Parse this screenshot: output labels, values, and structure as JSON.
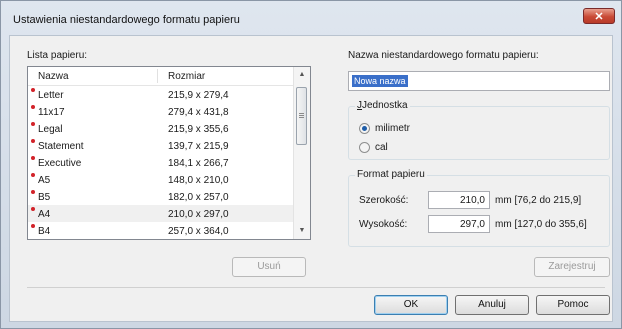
{
  "window": {
    "title": "Ustawienia niestandardowego formatu papieru",
    "close_glyph": "✕",
    "close_icon": "close-icon"
  },
  "paper_list": {
    "label": "Lista papieru:",
    "columns": [
      "Nazwa",
      "Rozmiar"
    ],
    "rows": [
      {
        "name": "Letter",
        "size": "215,9 x 279,4",
        "selected": false
      },
      {
        "name": "11x17",
        "size": "279,4 x 431,8",
        "selected": false
      },
      {
        "name": "Legal",
        "size": "215,9 x 355,6",
        "selected": false
      },
      {
        "name": "Statement",
        "size": "139,7 x 215,9",
        "selected": false
      },
      {
        "name": "Executive",
        "size": "184,1 x 266,7",
        "selected": false
      },
      {
        "name": "A5",
        "size": "148,0 x 210,0",
        "selected": false
      },
      {
        "name": "B5",
        "size": "182,0 x 257,0",
        "selected": false
      },
      {
        "name": "A4",
        "size": "210,0 x 297,0",
        "selected": true
      },
      {
        "name": "B4",
        "size": "257,0 x 364,0",
        "selected": false
      }
    ],
    "marker_color": "#d2232a",
    "scroll_up_glyph": "▲",
    "scroll_down_glyph": "▼"
  },
  "buttons": {
    "delete": "Usuń",
    "save": "Zarejestruj",
    "ok": "OK",
    "cancel": "Anuluj",
    "help": "Pomoc"
  },
  "custom_name": {
    "label": "Nazwa niestandardowego formatu papieru:",
    "value": "Nowa nazwa"
  },
  "unit": {
    "legend": "Jednostka",
    "options": [
      "milimetr",
      "cal"
    ],
    "selected": "milimetr"
  },
  "paper_format": {
    "legend": "Format papieru",
    "width": {
      "label": "Szerokość:",
      "value": "210,0",
      "range": "mm [76,2 do 215,9]"
    },
    "height": {
      "label": "Wysokość:",
      "value": "297,0",
      "range": "mm [127,0 do 355,6]"
    }
  }
}
